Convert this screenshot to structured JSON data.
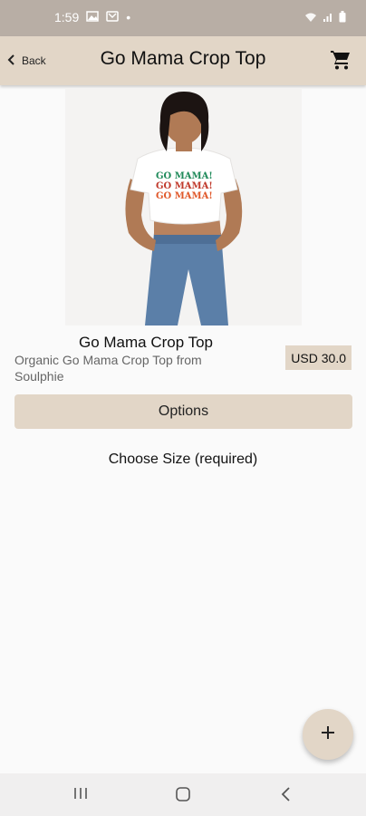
{
  "status_bar": {
    "time": "1:59",
    "dot": "•"
  },
  "app_bar": {
    "back_label": "Back",
    "title": "Go Mama Crop Top"
  },
  "product": {
    "name": "Go Mama Crop Top",
    "description": "Organic Go Mama Crop Top from Soulphie",
    "price": "USD 30.0",
    "shirt_print": [
      "GO MAMA!",
      "GO MAMA!",
      "GO MAMA!"
    ]
  },
  "options": {
    "label": "Options",
    "choose_size": "Choose Size (required)"
  },
  "fab": {
    "symbol": "+"
  },
  "colors": {
    "accent": "#e2d6c7",
    "status_bar": "#b8aea5",
    "background": "#fafafa"
  }
}
